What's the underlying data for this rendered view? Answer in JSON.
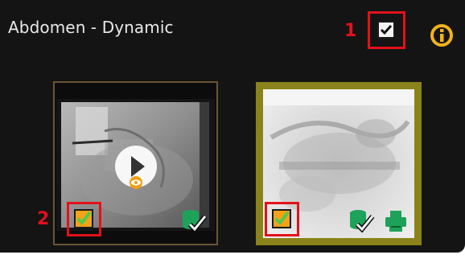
{
  "panel": {
    "title": "Abdomen - Dynamic"
  },
  "callouts": [
    {
      "number": "1"
    },
    {
      "number": "2"
    }
  ],
  "header_checkbox": {
    "checked": true
  },
  "thumbnails": [
    {
      "kind": "dynamic-series",
      "selected": false,
      "checked": true,
      "has_play": true,
      "status": [
        "archived-check"
      ]
    },
    {
      "kind": "static-image",
      "selected": true,
      "checked": true,
      "has_play": false,
      "status": [
        "archived-check",
        "print"
      ]
    }
  ],
  "colors": {
    "background": "#141414",
    "callout": "#e2111b",
    "selection_border": "#8a8319",
    "info_icon": "#f2b21a",
    "status_green": "#1ea25a",
    "check_orange": "#f3a21a"
  }
}
